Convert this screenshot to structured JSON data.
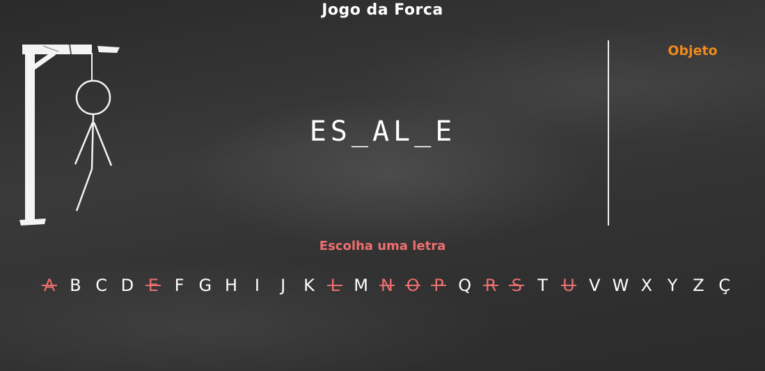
{
  "header": {
    "title": "Jogo da Forca"
  },
  "game": {
    "category": "Objeto",
    "word_display": "ES_AL_E",
    "prompt": "Escolha uma letra"
  },
  "alphabet": [
    {
      "letter": "A",
      "used": true
    },
    {
      "letter": "B",
      "used": false
    },
    {
      "letter": "C",
      "used": false
    },
    {
      "letter": "D",
      "used": false
    },
    {
      "letter": "E",
      "used": true
    },
    {
      "letter": "F",
      "used": false
    },
    {
      "letter": "G",
      "used": false
    },
    {
      "letter": "H",
      "used": false
    },
    {
      "letter": "I",
      "used": false
    },
    {
      "letter": "J",
      "used": false
    },
    {
      "letter": "K",
      "used": false
    },
    {
      "letter": "L",
      "used": true
    },
    {
      "letter": "M",
      "used": false
    },
    {
      "letter": "N",
      "used": true
    },
    {
      "letter": "O",
      "used": true
    },
    {
      "letter": "P",
      "used": true
    },
    {
      "letter": "Q",
      "used": false
    },
    {
      "letter": "R",
      "used": true
    },
    {
      "letter": "S",
      "used": true
    },
    {
      "letter": "T",
      "used": false
    },
    {
      "letter": "U",
      "used": true
    },
    {
      "letter": "V",
      "used": false
    },
    {
      "letter": "W",
      "used": false
    },
    {
      "letter": "X",
      "used": false
    },
    {
      "letter": "Y",
      "used": false
    },
    {
      "letter": "Z",
      "used": false
    },
    {
      "letter": "Ç",
      "used": false
    }
  ],
  "colors": {
    "category": "#f08a1c",
    "used_letter": "#ee6f6f",
    "chalk": "#ffffff"
  }
}
